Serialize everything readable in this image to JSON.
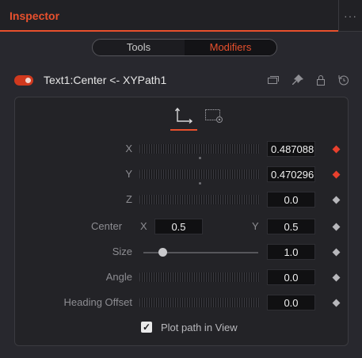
{
  "window": {
    "title": "Inspector",
    "more_label": "···"
  },
  "tabs": [
    {
      "label": "Tools",
      "active": false
    },
    {
      "label": "Modifiers",
      "active": true
    }
  ],
  "node": {
    "name": "Text1:Center <- XYPath1",
    "enabled": true,
    "icons": [
      "layers-icon",
      "pin-icon",
      "lock-icon",
      "reset-icon"
    ]
  },
  "subtabs": [
    "path-controls-icon",
    "settings-icon"
  ],
  "fields": {
    "x": {
      "label": "X",
      "value": "0.487088",
      "keyframed": true
    },
    "y": {
      "label": "Y",
      "value": "0.470296",
      "keyframed": true
    },
    "z": {
      "label": "Z",
      "value": "0.0",
      "keyframed": false
    },
    "center": {
      "label": "Center",
      "x_label": "X",
      "x_value": "0.5",
      "y_label": "Y",
      "y_value": "0.5"
    },
    "size": {
      "label": "Size",
      "value": "1.0",
      "slider_fraction": 0.17
    },
    "angle": {
      "label": "Angle",
      "value": "0.0"
    },
    "heading_offset": {
      "label": "Heading Offset",
      "value": "0.0"
    }
  },
  "plot_path": {
    "label": "Plot path in View",
    "checked": true,
    "check_glyph": "✓"
  },
  "colors": {
    "accent": "#e8502d",
    "keyframe_on": "#e8402d"
  }
}
